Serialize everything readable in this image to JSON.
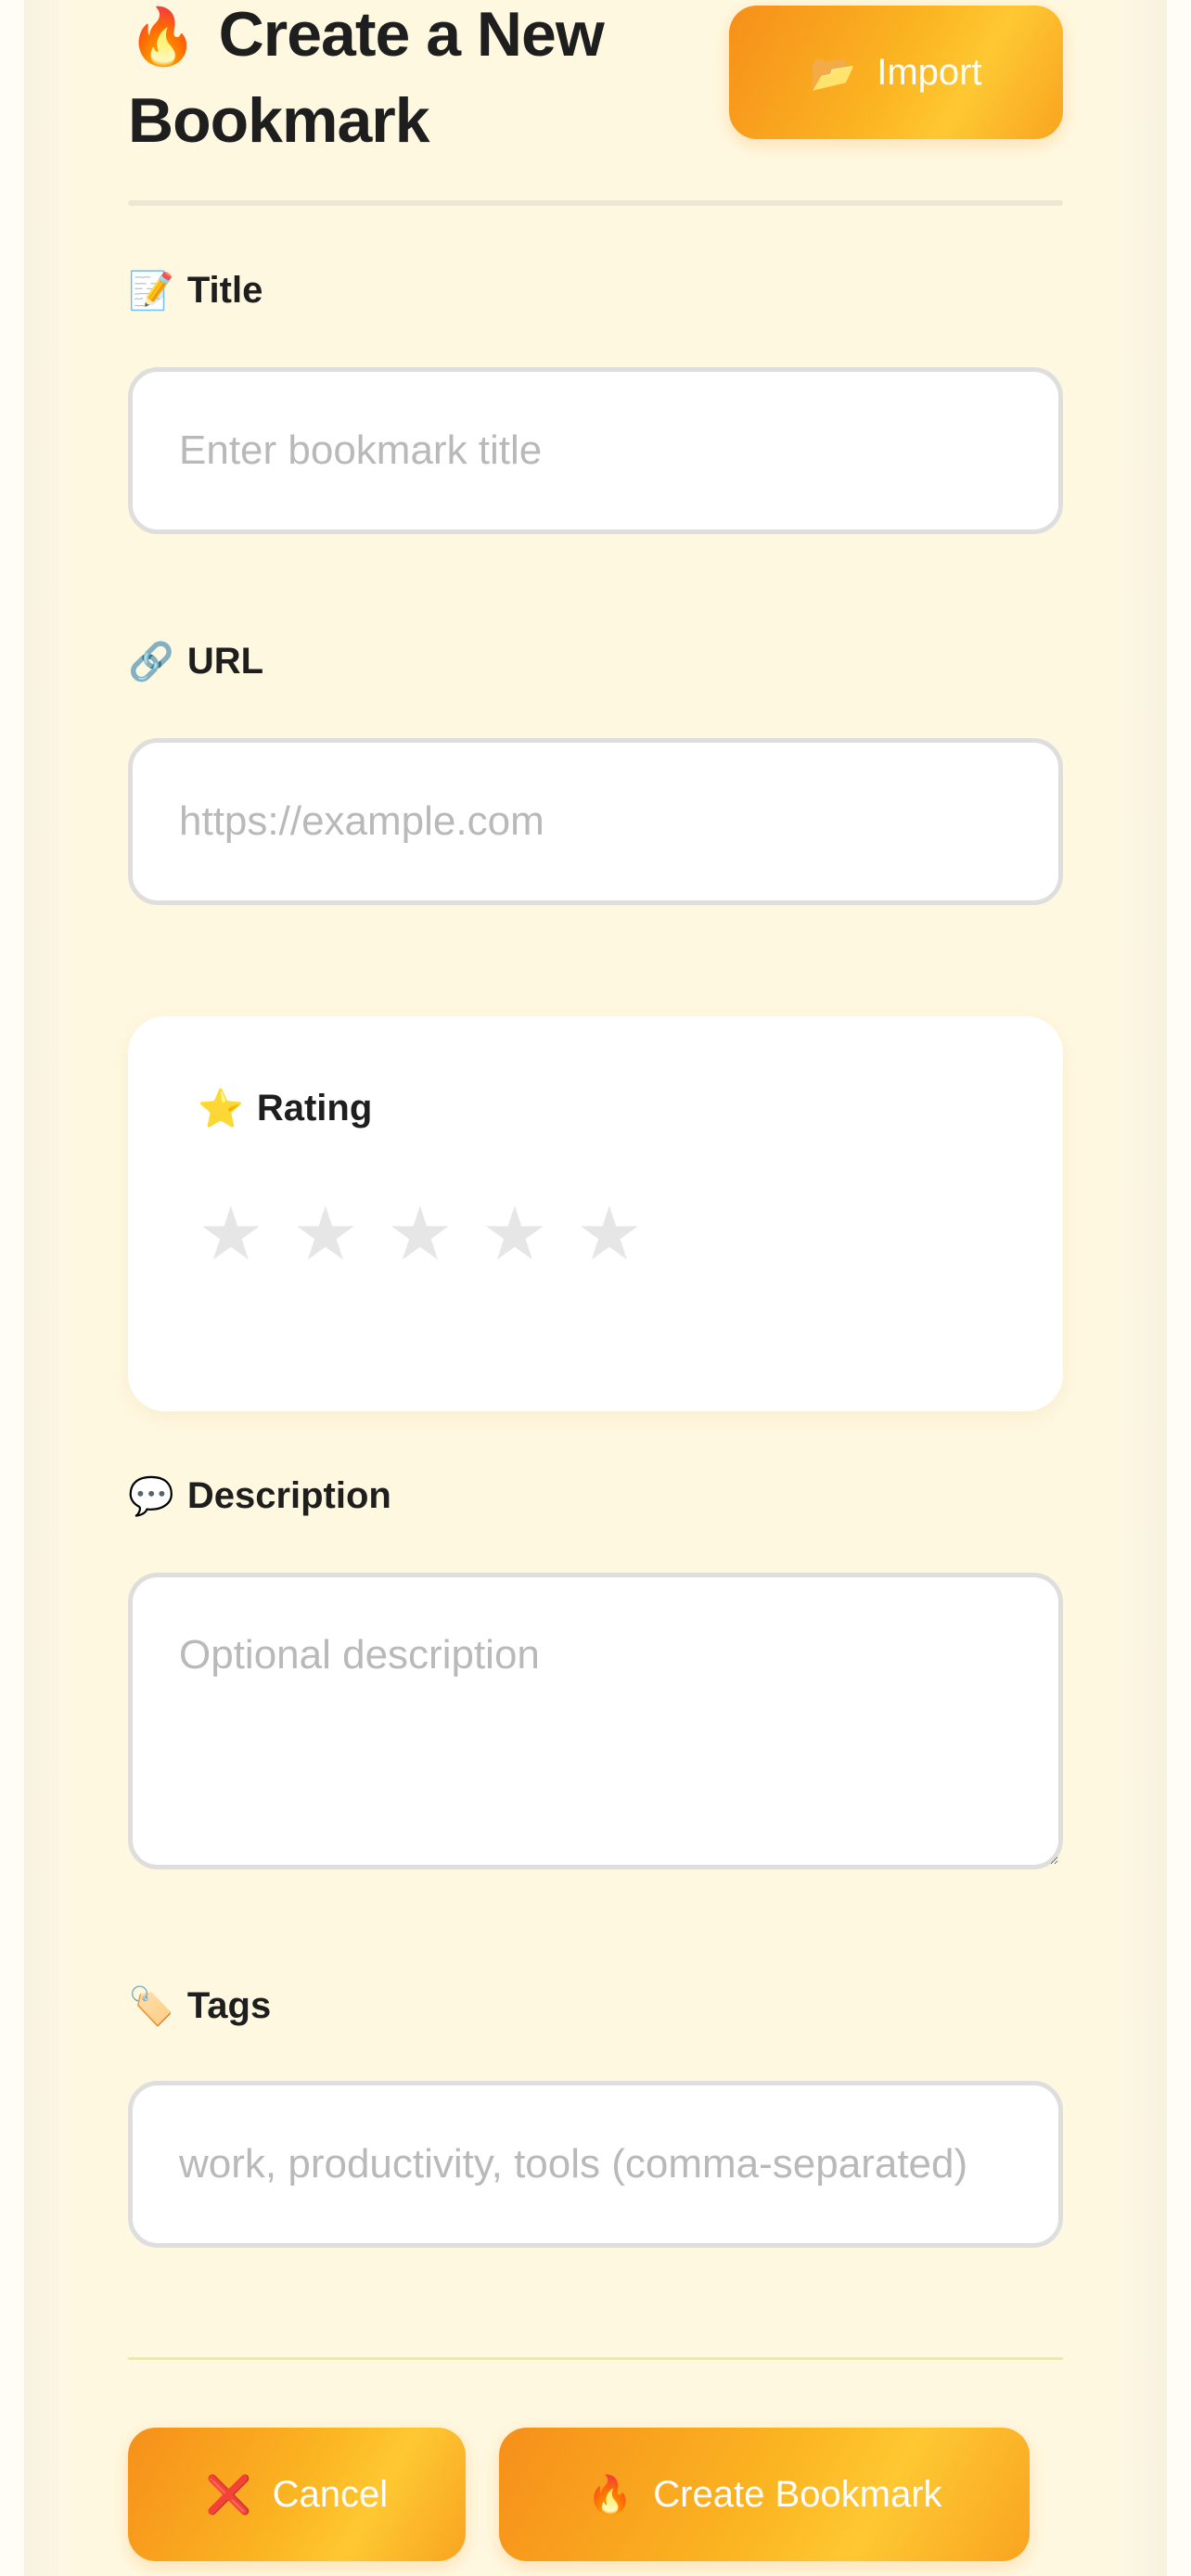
{
  "header": {
    "title_emoji": "🔥",
    "title": "Create a New Bookmark",
    "import_button": {
      "icon": "📂",
      "label": "Import"
    }
  },
  "form": {
    "title_field": {
      "icon": "📝",
      "label": "Title",
      "placeholder": "Enter bookmark title",
      "value": ""
    },
    "url_field": {
      "icon": "🔗",
      "label": "URL",
      "placeholder": "https://example.com",
      "value": ""
    },
    "rating": {
      "icon": "⭐",
      "label": "Rating",
      "stars": [
        "★",
        "★",
        "★",
        "★",
        "★"
      ],
      "value": 0,
      "max": 5
    },
    "description_field": {
      "icon": "💬",
      "label": "Description",
      "placeholder": "Optional description",
      "value": ""
    },
    "tags_field": {
      "icon": "🏷️",
      "label": "Tags",
      "placeholder": "work, productivity, tools (comma-separated)",
      "value": ""
    }
  },
  "actions": {
    "cancel": {
      "icon": "❌",
      "label": "Cancel"
    },
    "create": {
      "icon": "🔥",
      "label": "Create Bookmark"
    }
  },
  "colors": {
    "page_background": "#fdf8e4",
    "button_gradient_start": "#f68f1a",
    "button_gradient_end": "#fec832",
    "star_empty": "#e6e6e6",
    "text_primary": "#1e1e1e",
    "placeholder": "#b9b9b9"
  }
}
